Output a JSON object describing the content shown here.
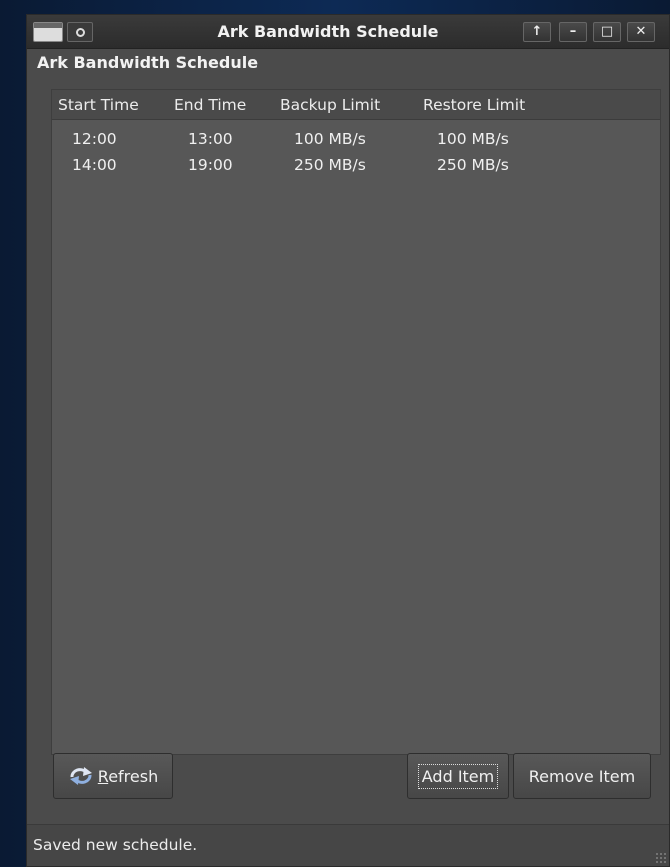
{
  "window": {
    "title": "Ark Bandwidth Schedule",
    "buttons": {
      "up": "↑",
      "minimize": "–",
      "maximize": "□",
      "close": "✕"
    },
    "icons": [
      "window-menu-icon",
      "sticky-icon"
    ]
  },
  "heading": "Ark Bandwidth Schedule",
  "table": {
    "columns": [
      "Start Time",
      "End Time",
      "Backup Limit",
      "Restore Limit"
    ],
    "rows": [
      [
        "12:00",
        "13:00",
        "100 MB/s",
        "100 MB/s"
      ],
      [
        "14:00",
        "19:00",
        "250 MB/s",
        "250 MB/s"
      ]
    ]
  },
  "buttons": {
    "refresh_first": "R",
    "refresh_rest": "efresh",
    "add_item": "Add Item",
    "remove_item": "Remove Item",
    "refresh_icon": "refresh-icon"
  },
  "status": "Saved new schedule."
}
